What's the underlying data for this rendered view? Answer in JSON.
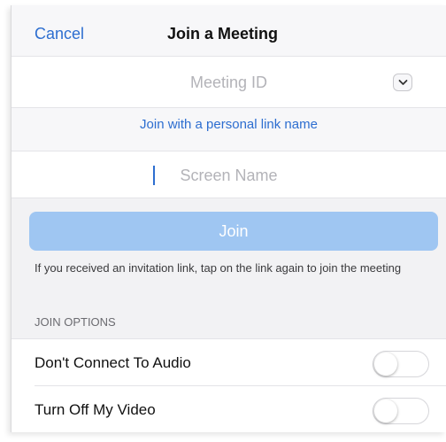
{
  "header": {
    "cancel_label": "Cancel",
    "title": "Join a Meeting"
  },
  "meeting_id": {
    "placeholder": "Meeting ID",
    "value": ""
  },
  "personal_link_label": "Join with a personal link name",
  "screen_name": {
    "placeholder": "Screen Name",
    "value": ""
  },
  "join_button_label": "Join",
  "hint_text": "If you received an invitation link, tap on the link again to join the meeting",
  "section_title": "JOIN OPTIONS",
  "options": [
    {
      "label": "Don't Connect To Audio",
      "toggle_on": false
    },
    {
      "label": "Turn Off My Video",
      "toggle_on": false
    }
  ],
  "colors": {
    "accent": "#2d6ed0",
    "join_button_disabled": "#9fc6f2",
    "background": "#f2f2f4"
  },
  "icons": {
    "dropdown": "chevron-down-icon"
  }
}
